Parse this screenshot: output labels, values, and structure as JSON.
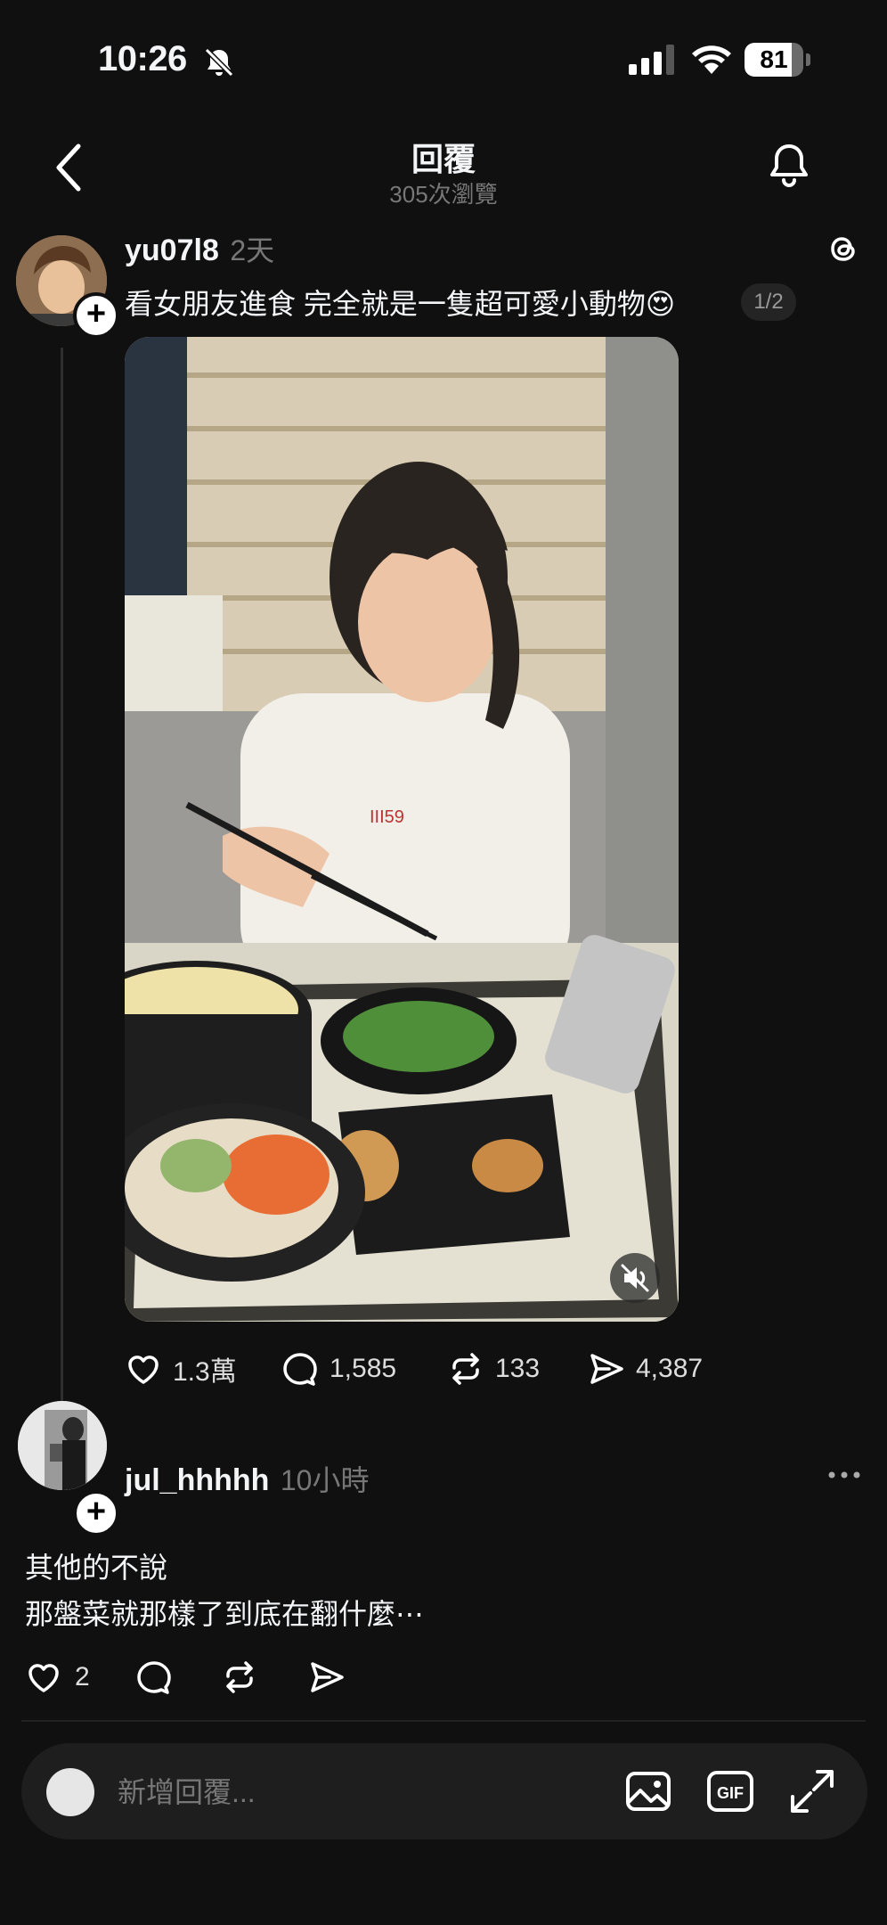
{
  "status_bar": {
    "time": "10:26",
    "battery_level": "81",
    "battery_fraction": 0.81,
    "icons": [
      "bell-slash-icon",
      "signal-icon",
      "wifi-icon",
      "battery-icon"
    ]
  },
  "header": {
    "title": "回覆",
    "views": "305次瀏覽",
    "icons": [
      "back-chevron-icon",
      "bell-icon"
    ]
  },
  "post": {
    "username": "yu07l8",
    "time_ago": "2天",
    "caption": "看女朋友進食 完全就是一隻超可愛小動物😍",
    "pager": "1/2",
    "actions": {
      "likes": "1.3萬",
      "comments": "1,585",
      "reposts": "133",
      "shares": "4,387"
    }
  },
  "reply": {
    "username": "jul_hhhhh",
    "time_ago": "10小時",
    "line1": "其他的不說",
    "line2": "那盤菜就那樣了到底在翻什麼⋯",
    "likes": "2"
  },
  "composer": {
    "placeholder": "新增回覆...",
    "gif_label": "GIF"
  },
  "colors": {
    "background": "#101010",
    "text_primary": "#f3f5f7",
    "text_secondary": "#777777"
  }
}
